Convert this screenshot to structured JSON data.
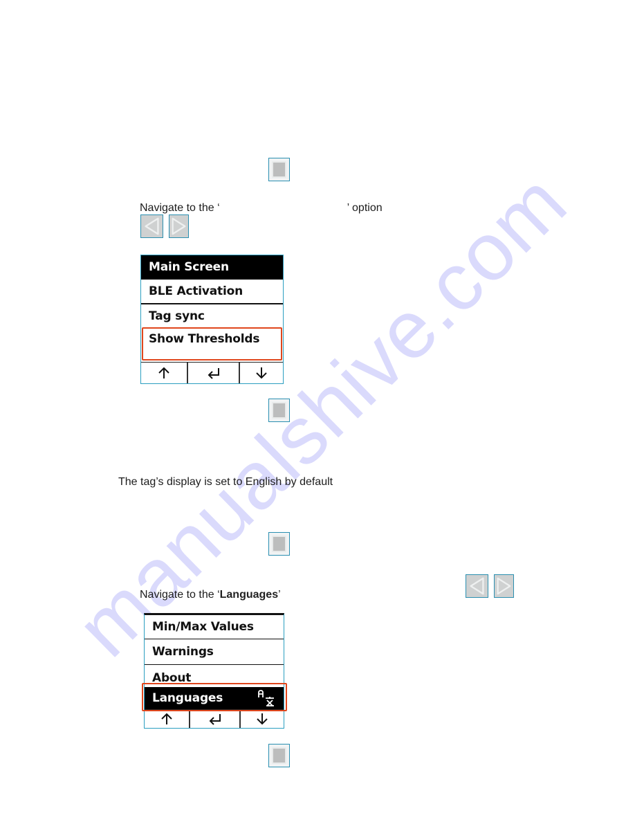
{
  "section1": {
    "instruction_prefix": "Navigate to the ‘",
    "instruction_suffix": "’ option",
    "menu": {
      "items": [
        {
          "label": "Main Screen",
          "selected": true
        },
        {
          "label": "BLE Activation",
          "selected": false
        },
        {
          "label": "Tag sync",
          "selected": false
        },
        {
          "label": "Show Thresholds",
          "selected": false,
          "highlighted": true
        }
      ],
      "softkeys": [
        "up-arrow",
        "enter",
        "down-arrow"
      ]
    }
  },
  "section2": {
    "note": "The tag’s display is set to English by default",
    "instruction_prefix": "Navigate to the ‘",
    "instruction_bold": "Languages",
    "instruction_suffix": "’",
    "menu": {
      "items": [
        {
          "label": "Min/Max Values",
          "selected": false
        },
        {
          "label": "Warnings",
          "selected": false
        },
        {
          "label": "About",
          "selected": false
        },
        {
          "label": "Languages",
          "selected": true,
          "highlighted": true,
          "icon": "translate-icon"
        }
      ],
      "softkeys": [
        "up-arrow",
        "enter",
        "down-arrow"
      ]
    }
  },
  "icons": {
    "ok_button": "square-ok-button",
    "left_arrow": "left-triangle-button",
    "right_arrow": "right-triangle-button"
  },
  "colors": {
    "highlight": "#e0461c",
    "screen_border": "#2a9ec0",
    "button_border": "#2a8fb0",
    "watermark": "#8c8cf5"
  },
  "watermark": "manualshive.com"
}
